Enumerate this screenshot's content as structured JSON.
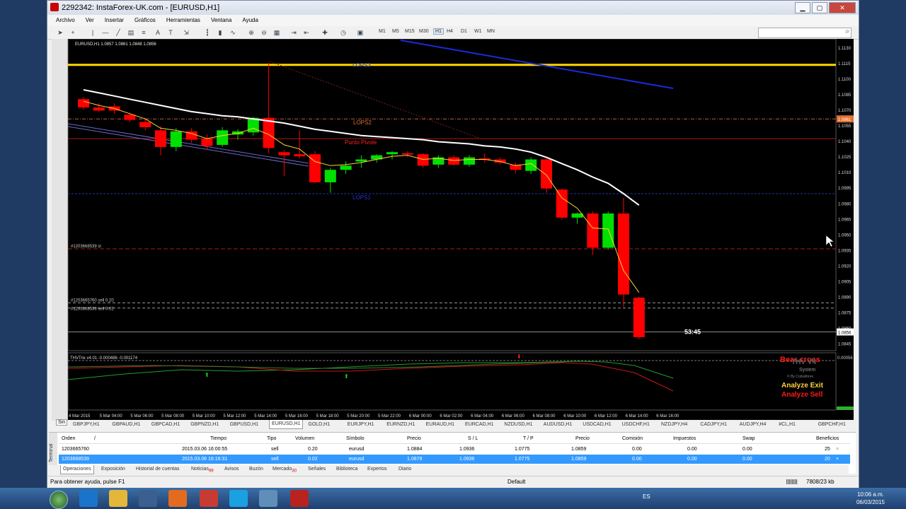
{
  "window": {
    "title": "2292342: InstaForex-UK.com - [EURUSD,H1]"
  },
  "menu": [
    "Archivo",
    "Ver",
    "Insertar",
    "Gráficos",
    "Herramientas",
    "Ventana",
    "Ayuda"
  ],
  "timeframes": [
    "M1",
    "M5",
    "M15",
    "M30",
    "H1",
    "H4",
    "D1",
    "W1",
    "MN"
  ],
  "timeframe_selected": "H1",
  "chart": {
    "header": "EURUSD,H1  1.0857 1.0861 1.0848 1.0856",
    "price_labels": [
      "1.1130",
      "1.1115",
      "1.1100",
      "1.1085",
      "1.1070",
      "1.1055",
      "1.1040",
      "1.1025",
      "1.1010",
      "1.0995",
      "1.0980",
      "1.0965",
      "1.0950",
      "1.0935",
      "1.0920",
      "1.0905",
      "1.0890",
      "1.0875",
      "1.0860",
      "1.0845"
    ],
    "level_lops2": "LOPS2",
    "level_pivot": "Punto Pivote",
    "level_lops1": "LOPS1",
    "level_top": "LOPS3",
    "current_price_tag": "1.0856",
    "marker_price_tag": "1.0861",
    "order_sl": "#1203668539 sl",
    "order_sell1": "#1203665760 sell 0.20",
    "order_sell2": "#1203668539 sell 0.02",
    "countdown": "53:45",
    "indicator_header": "THVTrix v4.01 -0.000486 -0.001174",
    "indicator_price": "0.00056",
    "brand_big": "Bear cross",
    "brand_small1": "THV V4",
    "brand_small2": "System",
    "brand_small3": "© By Cobraforex",
    "analyze_exit": "Analyze Exit",
    "analyze_sell": "Analyze Sell",
    "time_labels": [
      "4 Mar 2015",
      "5 Mar 04:00",
      "5 Mar 06:00",
      "5 Mar 08:00",
      "5 Mar 10:00",
      "5 Mar 12:00",
      "5 Mar 14:00",
      "5 Mar 16:00",
      "5 Mar 18:00",
      "5 Mar 20:00",
      "5 Mar 22:00",
      "6 Mar 00:00",
      "6 Mar 02:00",
      "6 Mar 04:00",
      "6 Mar 06:00",
      "6 Mar 08:00",
      "6 Mar 10:00",
      "6 Mar 12:00",
      "6 Mar 14:00",
      "6 Mar 16:00"
    ]
  },
  "symbol_tabs": [
    "GBPJPY,H1",
    "GBPAUD,H1",
    "GBPCAD,H1",
    "GBPNZD,H1",
    "GBPUSD,H1",
    "EURUSD,H1",
    "GOLD,H1",
    "EURJPY,H1",
    "EURNZD,H1",
    "EURAUD,H1",
    "EURCAD,H1",
    "NZDUSD,H1",
    "AUDUSD,H1",
    "USDCAD,H1",
    "USDCHF,H1",
    "NZDJPY,H4",
    "CADJPY,H1",
    "AUDJPY,H4",
    "#CL,H1",
    "GBPCHF,H1"
  ],
  "symbol_tab_active": "EURUSD,H1",
  "symbol_tab_head": "Sin",
  "terminal": {
    "label": "Terminal",
    "headers": {
      "orden": "Orden",
      "orden_sort": "/",
      "tiempo": "Tiempo",
      "tipo": "Tipo",
      "volumen": "Volumen",
      "simbolo": "Símbolo",
      "precio": "Precio",
      "sl": "S / L",
      "tp": "T / P",
      "precio2": "Precio",
      "comision": "Comisión",
      "impuestos": "Impuestos",
      "swap": "Swap",
      "beneficios": "Beneficios"
    },
    "rows": [
      {
        "orden": "1203665760",
        "tiempo": "2015.03.06 16:00:55",
        "tipo": "sell",
        "volumen": "0.20",
        "simbolo": "eurusd",
        "precio": "1.0884",
        "sl": "1.0936",
        "tp": "1.0775",
        "precio2": "1.0859",
        "comision": "0.00",
        "impuestos": "0.00",
        "swap": "0.00",
        "beneficios": "25"
      },
      {
        "orden": "1203668539",
        "tiempo": "2015.03.06 16:16:31",
        "tipo": "sell",
        "volumen": "0.02",
        "simbolo": "eurusd",
        "precio": "1.0879",
        "sl": "1.0936",
        "tp": "1.0775",
        "precio2": "1.0859",
        "comision": "0.00",
        "impuestos": "0.00",
        "swap": "0.00",
        "beneficios": "20"
      }
    ],
    "close_glyph": "×"
  },
  "bottom_tabs": [
    {
      "label": "Operaciones",
      "badge": ""
    },
    {
      "label": "Exposición",
      "badge": ""
    },
    {
      "label": "Historial de cuentas",
      "badge": ""
    },
    {
      "label": "Noticias",
      "badge": "99"
    },
    {
      "label": "Avisos",
      "badge": ""
    },
    {
      "label": "Buzón",
      "badge": ""
    },
    {
      "label": "Mercado",
      "badge": "30"
    },
    {
      "label": "Señales",
      "badge": ""
    },
    {
      "label": "Biblioteca",
      "badge": ""
    },
    {
      "label": "Expertos",
      "badge": ""
    },
    {
      "label": "Diario",
      "badge": ""
    }
  ],
  "status": {
    "help": "Para obtener ayuda, pulse F1",
    "profile": "Default",
    "traffic": "7808/23 kb"
  },
  "taskbar": {
    "lang": "ES",
    "time": "10:06 a.m.",
    "date": "06/03/2015"
  },
  "colors": {
    "up": "#00e000",
    "down": "#ff0000",
    "ma_white": "#ffffff",
    "ma_yellow": "#ffd23c",
    "ma_blue": "#1a2ad8",
    "level_yellow": "#ffd700",
    "accent_select": "#3399ff"
  }
}
